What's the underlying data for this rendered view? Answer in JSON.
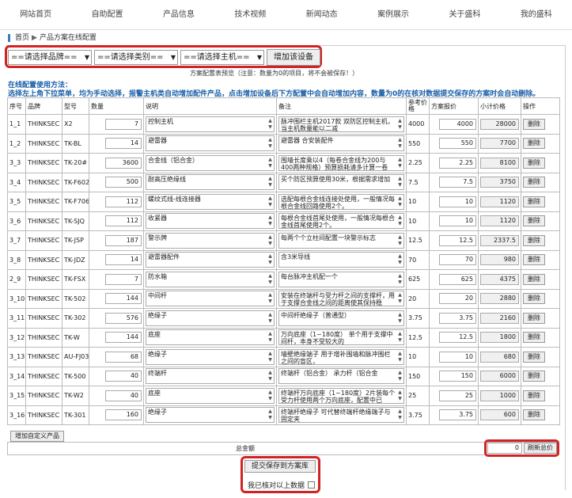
{
  "nav": [
    "网站首页",
    "自助配置",
    "产品信息",
    "技术视频",
    "新闻动态",
    "案例展示",
    "关于盛科",
    "我的盛科"
  ],
  "breadcrumb": {
    "home": "首页",
    "sep": "▶",
    "current": "产品方案在线配置"
  },
  "selectors": {
    "brand": "==请选择品牌==",
    "category": "==请选择类别==",
    "host": "==请选择主机=="
  },
  "add_device_label": "增加该设备",
  "preview_note": "方案配置表预览（注意：数量为0的项目，将不会被保存！）",
  "instructions": {
    "title": "在线配置使用方法：",
    "body": "选择左上角下拉菜单，均为手动选择，报警主机类自动增加配件产品，点击增加设备后下方配置中会自动增加内容，数量为0的在核对数据提交保存的方案时会自动删除。"
  },
  "columns": [
    "序号",
    "品牌",
    "型号",
    "数量",
    "说明",
    "备注",
    "参考价格",
    "方案报价",
    "小计价格",
    "操作"
  ],
  "rows": [
    {
      "seq": "1_1",
      "brand": "THINKSEC",
      "model": "X2",
      "qty": "7",
      "desc": "控制主机",
      "note": "脉冲围栏主机2017款 双防区控制主机，当主机数量能以二减",
      "ref": "4000",
      "quote": "4000",
      "subtotal": "28000",
      "del": "删除"
    },
    {
      "seq": "1_2",
      "brand": "THINKSEC",
      "model": "TK-BL",
      "qty": "14",
      "desc": "避雷器",
      "note": "避雷器 合安装配件",
      "ref": "550",
      "quote": "550",
      "subtotal": "7700",
      "del": "删除"
    },
    {
      "seq": "3_3",
      "brand": "THINKSEC",
      "model": "TK-20#",
      "qty": "3600",
      "desc": "合金线（铝合金）",
      "note": "围墙长度乘以4（每卷合金线为200与400两种规格）预算损耗请多计算一卷",
      "ref": "2.25",
      "quote": "2.25",
      "subtotal": "8100",
      "del": "删除"
    },
    {
      "seq": "3_4",
      "brand": "THINKSEC",
      "model": "TK-F602",
      "qty": "500",
      "desc": "耐高压绝缘线",
      "note": "买个防区预算使用30米，根据需求增加",
      "ref": "7.5",
      "quote": "7.5",
      "subtotal": "3750",
      "del": "删除"
    },
    {
      "seq": "3_5",
      "brand": "THINKSEC",
      "model": "TK-F706",
      "qty": "112",
      "desc": "螺纹式线-线连接器",
      "note": "选配每根合金线连接处使用，一般情况每根合金线回路使用2个。",
      "ref": "10",
      "quote": "10",
      "subtotal": "1120",
      "del": "删除"
    },
    {
      "seq": "3_6",
      "brand": "THINKSEC",
      "model": "TK-SJQ",
      "qty": "112",
      "desc": "收紧器",
      "note": "每根合金线首尾处使用，一般情况每根合金线首尾使用2个。",
      "ref": "10",
      "quote": "10",
      "subtotal": "1120",
      "del": "删除"
    },
    {
      "seq": "3_7",
      "brand": "THINKSEC",
      "model": "TK-JSP",
      "qty": "187",
      "desc": "警示牌",
      "note": "每两个个立柱间配置一块警示标志",
      "ref": "12.5",
      "quote": "12.5",
      "subtotal": "2337.5",
      "del": "删除"
    },
    {
      "seq": "3_8",
      "brand": "THINKSEC",
      "model": "TK-JDZ",
      "qty": "14",
      "desc": "避雷器配件",
      "note": "含3米导线",
      "ref": "70",
      "quote": "70",
      "subtotal": "980",
      "del": "删除"
    },
    {
      "seq": "2_9",
      "brand": "THINKSEC",
      "model": "TK-FSX",
      "qty": "7",
      "desc": "防水箱",
      "note": "每台脉冲主机配一个",
      "ref": "625",
      "quote": "625",
      "subtotal": "4375",
      "del": "删除"
    },
    {
      "seq": "3_10",
      "brand": "THINKSEC",
      "model": "TK-502",
      "qty": "144",
      "desc": "中间杆",
      "note": "安装在终端杆与受力杆之间的支撑杆，用于支撑合金线之间的距离使其保持稳",
      "ref": "20",
      "quote": "20",
      "subtotal": "2880",
      "del": "删除"
    },
    {
      "seq": "3_11",
      "brand": "THINKSEC",
      "model": "TK-302",
      "qty": "576",
      "desc": "绝缘子",
      "note": "中间杆绝缘子（普通型）",
      "ref": "3.75",
      "quote": "3.75",
      "subtotal": "2160",
      "del": "删除"
    },
    {
      "seq": "3_12",
      "brand": "THINKSEC",
      "model": "TK-W",
      "qty": "144",
      "desc": "底座",
      "note": "万向底座（1~180度） 单个用于支撑中间杆，本身不受较大的",
      "ref": "12.5",
      "quote": "12.5",
      "subtotal": "1800",
      "del": "删除"
    },
    {
      "seq": "3_13",
      "brand": "THINKSEC",
      "model": "AU-FJ032",
      "qty": "68",
      "desc": "绝缘子",
      "note": "墙壁绝缘端子 用于增补围墙和脉冲围栏之间的盲区，",
      "ref": "10",
      "quote": "10",
      "subtotal": "680",
      "del": "删除"
    },
    {
      "seq": "3_14",
      "brand": "THINKSEC",
      "model": "TK-500",
      "qty": "40",
      "desc": "终端杆",
      "note": "终端杆（铝合金） 承力杆（铝合金",
      "ref": "150",
      "quote": "150",
      "subtotal": "6000",
      "del": "删除"
    },
    {
      "seq": "3_15",
      "brand": "THINKSEC",
      "model": "TK-W2",
      "qty": "40",
      "desc": "底座",
      "note": "终端杆万向底座（1~180度）2片装每个受力杆使用两个万向底座，配置中已",
      "ref": "25",
      "quote": "25",
      "subtotal": "1000",
      "del": "删除"
    },
    {
      "seq": "3_16",
      "brand": "THINKSEC",
      "model": "TK-301",
      "qty": "160",
      "desc": "绝缘子",
      "note": "终端杆绝缘子 可代替终端杆绝缘端子与固定夹",
      "ref": "3.75",
      "quote": "3.75",
      "subtotal": "600",
      "del": "删除"
    }
  ],
  "add_custom_label": "增加自定义产品",
  "total": {
    "label": "总金额",
    "value": "0",
    "refresh_label": "刷新总价"
  },
  "save_label": "提交保存到方案库",
  "confirm_label": "我已核对以上数据",
  "colors": {
    "highlight": "#d12323",
    "instruction": "#1a5fa8"
  }
}
